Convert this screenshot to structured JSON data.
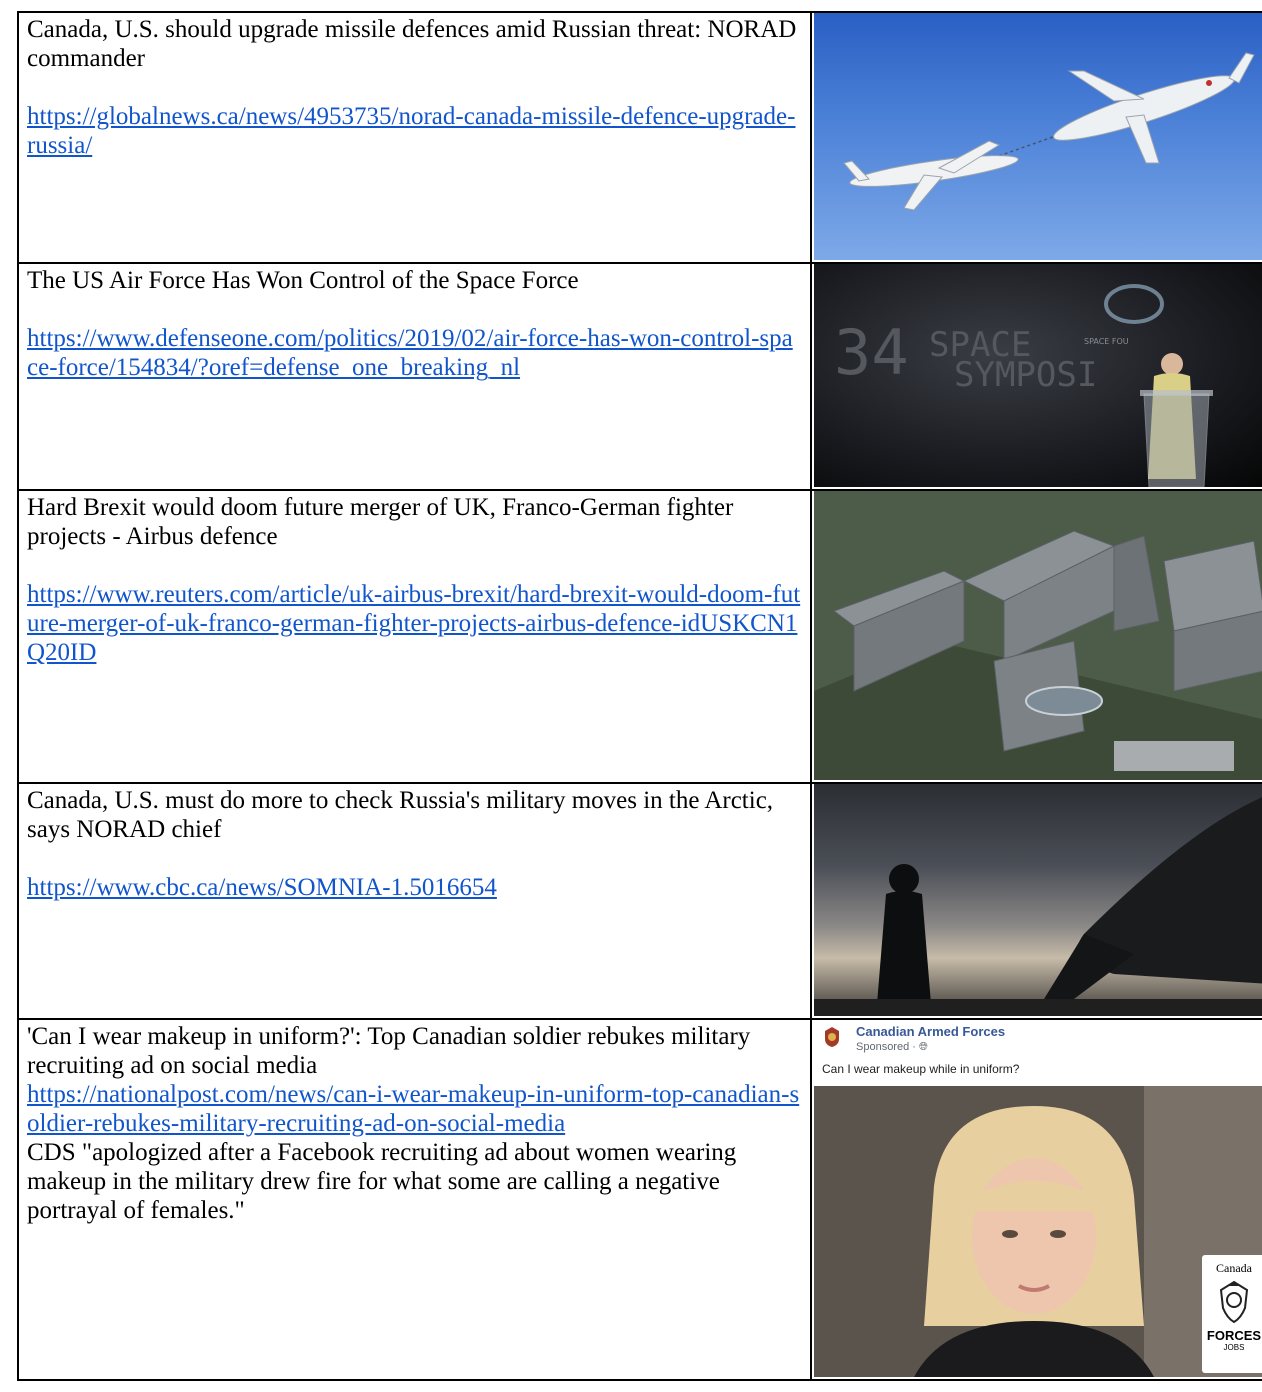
{
  "rows": [
    {
      "headline": "Canada, U.S. should upgrade missile defences amid Russian threat: NORAD commander",
      "url": "https://globalnews.ca/news/4953735/norad-canada-missile-defence-upgrade-russia/",
      "image": "two-aircraft-sky-photo"
    },
    {
      "headline": "The US Air Force Has Won Control of the Space Force",
      "url": "https://www.defenseone.com/politics/2019/02/air-force-has-won-control-space-force/154834/?oref=defense_one_breaking_nl",
      "image": "space-symposium-speaker-photo",
      "image_text": {
        "main1": "34",
        "main2": "SPACE",
        "main3": "SYMPOSI",
        "small": "SPACE FOU"
      }
    },
    {
      "headline": "Hard Brexit would doom future merger of UK, Franco-German fighter projects - Airbus defence",
      "url": "https://www.reuters.com/article/uk-airbus-brexit/hard-brexit-would-doom-future-merger-of-uk-franco-german-fighter-projects-airbus-defence-idUSKCN1Q20ID",
      "image": "aerial-buildings-photo"
    },
    {
      "headline": "Canada, U.S. must do more to check Russia's military moves in the Arctic, says NORAD chief",
      "url": "https://www.cbc.ca/news/SOMNIA-1.5016654",
      "image": "silhouette-aircraft-photo"
    },
    {
      "headline": "'Can I wear makeup in uniform?': Top Canadian soldier rebukes military recruiting ad on social media",
      "url": "https://nationalpost.com/news/can-i-wear-makeup-in-uniform-top-canadian-soldier-rebukes-military-recruiting-ad-on-social-media",
      "note": "CDS \"apologized after a Facebook recruiting ad about women wearing makeup in the military drew fire for what some are calling a negative portrayal of females.\"",
      "image": "facebook-ad-screenshot",
      "ad": {
        "page_name": "Canadian Armed Forces",
        "sponsored": "Sponsored · ",
        "post_text": "Can I wear makeup while in uniform?",
        "badge_top": "Canada",
        "badge_main": "FORCES",
        "badge_sub": "JOBS"
      }
    }
  ],
  "colors": {
    "link": "#1155cc",
    "border": "#000000",
    "fb_name": "#385898"
  }
}
